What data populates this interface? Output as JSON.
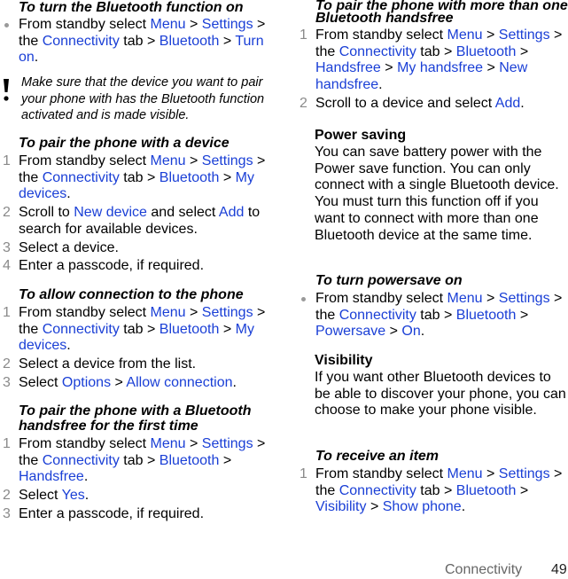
{
  "left": {
    "turn_on": {
      "heading": "To turn the Bluetooth function on",
      "bullet": [
        {
          "t": "From standby select "
        },
        {
          "l": "Menu"
        },
        {
          "t": " > "
        },
        {
          "l": "Settings"
        },
        {
          "t": " > the "
        },
        {
          "l": "Connectivity"
        },
        {
          "t": " tab > "
        },
        {
          "l": "Bluetooth"
        },
        {
          "t": " > "
        },
        {
          "l": "Turn on"
        },
        {
          "t": "."
        }
      ]
    },
    "note": {
      "icon": "exclamation-icon",
      "text": "Make sure that the device you want to pair your phone with has the Bluetooth function activated and is made visible."
    },
    "pair_device": {
      "heading": "To pair the phone with a device",
      "steps": [
        {
          "num": "1",
          "parts": [
            {
              "t": "From standby select "
            },
            {
              "l": "Menu"
            },
            {
              "t": " > "
            },
            {
              "l": "Settings"
            },
            {
              "t": " > the "
            },
            {
              "l": "Connectivity"
            },
            {
              "t": " tab > "
            },
            {
              "l": "Bluetooth"
            },
            {
              "t": " > "
            },
            {
              "l": "My devices"
            },
            {
              "t": "."
            }
          ]
        },
        {
          "num": "2",
          "parts": [
            {
              "t": "Scroll to "
            },
            {
              "l": "New device"
            },
            {
              "t": " and select "
            },
            {
              "l": "Add"
            },
            {
              "t": " to search for available devices."
            }
          ]
        },
        {
          "num": "3",
          "parts": [
            {
              "t": "Select a device."
            }
          ]
        },
        {
          "num": "4",
          "parts": [
            {
              "t": "Enter a passcode, if required."
            }
          ]
        }
      ]
    },
    "allow_connection": {
      "heading": "To allow connection to the phone",
      "steps": [
        {
          "num": "1",
          "parts": [
            {
              "t": "From standby select "
            },
            {
              "l": "Menu"
            },
            {
              "t": " > "
            },
            {
              "l": "Settings"
            },
            {
              "t": " > the "
            },
            {
              "l": "Connectivity"
            },
            {
              "t": " tab > "
            },
            {
              "l": "Bluetooth"
            },
            {
              "t": " > "
            },
            {
              "l": "My devices"
            },
            {
              "t": "."
            }
          ]
        },
        {
          "num": "2",
          "parts": [
            {
              "t": "Select a device from the list."
            }
          ]
        },
        {
          "num": "3",
          "parts": [
            {
              "t": "Select "
            },
            {
              "l": "Options"
            },
            {
              "t": " > "
            },
            {
              "l": "Allow connection"
            },
            {
              "t": "."
            }
          ]
        }
      ]
    },
    "pair_handsfree": {
      "heading": "To pair the phone with a Bluetooth handsfree for the first time",
      "steps": [
        {
          "num": "1",
          "parts": [
            {
              "t": "From standby select "
            },
            {
              "l": "Menu"
            },
            {
              "t": " > "
            },
            {
              "l": "Settings"
            },
            {
              "t": " > the "
            },
            {
              "l": "Connectivity"
            },
            {
              "t": " tab > "
            },
            {
              "l": "Bluetooth"
            },
            {
              "t": " > "
            },
            {
              "l": "Handsfree"
            },
            {
              "t": "."
            }
          ]
        },
        {
          "num": "2",
          "parts": [
            {
              "t": "Select "
            },
            {
              "l": "Yes"
            },
            {
              "t": "."
            }
          ]
        },
        {
          "num": "3",
          "parts": [
            {
              "t": "Enter a passcode, if required."
            }
          ]
        }
      ]
    }
  },
  "right": {
    "pair_multi": {
      "heading": "To pair the phone with more than one Bluetooth handsfree",
      "steps": [
        {
          "num": "1",
          "parts": [
            {
              "t": "From standby select "
            },
            {
              "l": "Menu"
            },
            {
              "t": " > "
            },
            {
              "l": "Settings"
            },
            {
              "t": " > the "
            },
            {
              "l": "Connectivity"
            },
            {
              "t": " tab > "
            },
            {
              "l": "Bluetooth"
            },
            {
              "t": " > "
            },
            {
              "l": "Handsfree"
            },
            {
              "t": " > "
            },
            {
              "l": "My handsfree"
            },
            {
              "t": " > "
            },
            {
              "l": "New handsfree"
            },
            {
              "t": "."
            }
          ]
        },
        {
          "num": "2",
          "parts": [
            {
              "t": "Scroll to a device and select "
            },
            {
              "l": "Add"
            },
            {
              "t": "."
            }
          ]
        }
      ]
    },
    "power_saving": {
      "title": "Power saving",
      "text": "You can save battery power with the Power save function. You can only connect with a single Bluetooth device. You must turn this function off if you want to connect with more than one Bluetooth device at the same time."
    },
    "powersave_on": {
      "heading": "To turn powersave on",
      "bullet": [
        {
          "t": "From standby select "
        },
        {
          "l": "Menu"
        },
        {
          "t": " > "
        },
        {
          "l": "Settings"
        },
        {
          "t": " > the "
        },
        {
          "l": "Connectivity"
        },
        {
          "t": " tab > "
        },
        {
          "l": "Bluetooth"
        },
        {
          "t": " > "
        },
        {
          "l": "Powersave"
        },
        {
          "t": " > "
        },
        {
          "l": "On"
        },
        {
          "t": "."
        }
      ]
    },
    "visibility": {
      "title": "Visibility",
      "text": "If you want other Bluetooth devices to be able to discover your phone, you can choose to make your phone visible."
    },
    "receive_item": {
      "heading": "To receive an item",
      "steps": [
        {
          "num": "1",
          "parts": [
            {
              "t": "From standby select "
            },
            {
              "l": "Menu"
            },
            {
              "t": " > "
            },
            {
              "l": "Settings"
            },
            {
              "t": " > the "
            },
            {
              "l": "Connectivity"
            },
            {
              "t": " tab > "
            },
            {
              "l": "Bluetooth"
            },
            {
              "t": " > "
            },
            {
              "l": "Visibility"
            },
            {
              "t": " > "
            },
            {
              "l": "Show phone"
            },
            {
              "t": "."
            }
          ]
        }
      ]
    }
  },
  "footer": {
    "section": "Connectivity",
    "page": "49"
  },
  "colors": {
    "link": "#1a3fd6",
    "marker": "#8a8a8a"
  }
}
